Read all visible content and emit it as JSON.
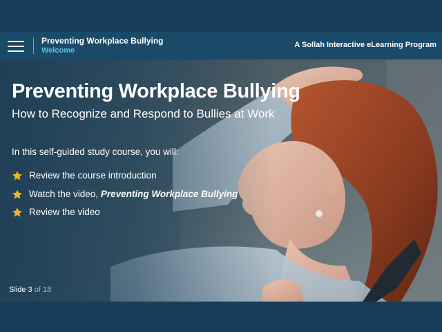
{
  "header": {
    "menu_icon": "hamburger-menu-icon",
    "course_title": "Preventing Workplace Bullying",
    "section_title": "Welcome",
    "brand": "A Sollah Interactive eLearning Program"
  },
  "slide": {
    "title": "Preventing Workplace Bullying",
    "subtitle": "How to Recognize and Respond to Bullies at Work",
    "intro": "In this self-guided study course, you will:",
    "bullets": [
      {
        "text": "Review the course introduction",
        "emphasis": ""
      },
      {
        "text": "Watch the video, ",
        "emphasis": "Preventing Workplace Bullying"
      },
      {
        "text": "Review the video",
        "emphasis": ""
      }
    ],
    "bullet_icon": "star-icon",
    "image": "woman-hand-on-head-stressed-photo"
  },
  "progress": {
    "prefix": "Slide",
    "current": "3",
    "separator": "of",
    "total": "18"
  },
  "colors": {
    "background": "#173e58",
    "header_bar": "#1a4a68",
    "accent_blue": "#5cc0e8",
    "star": "#f2b51e",
    "text": "#ffffff"
  }
}
